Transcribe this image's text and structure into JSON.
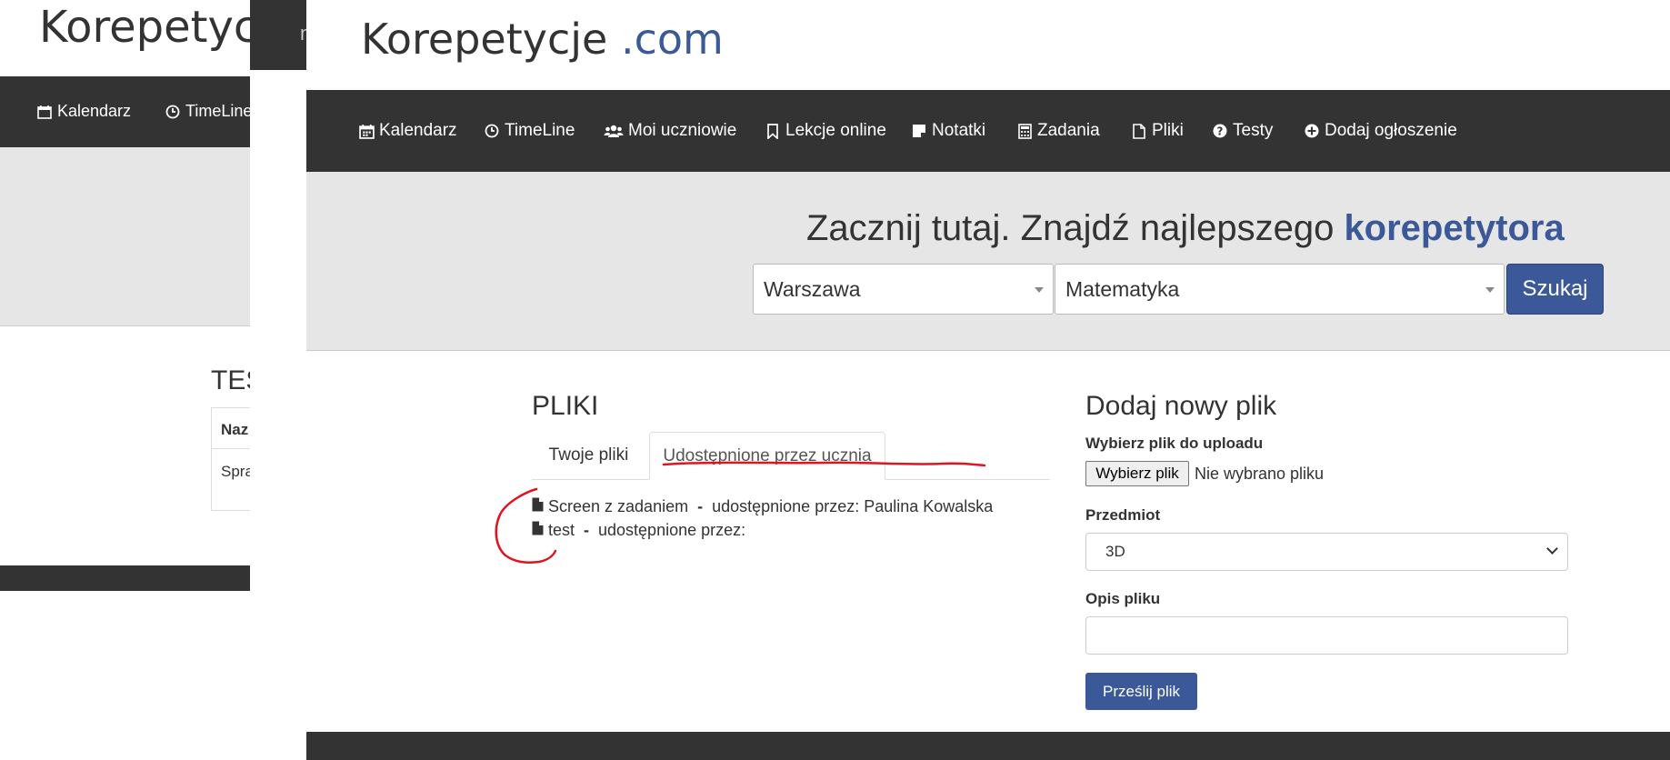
{
  "background_window": {
    "brand_fragment": "Korepetycje",
    "top_bar_glyph": "m",
    "nav": [
      {
        "icon": "calendar-icon",
        "label": "Kalendarz"
      },
      {
        "icon": "clock-icon",
        "label": "TimeLine"
      }
    ],
    "section_title_fragment": "TES",
    "table_header_fragment": "Naz",
    "table_cell_fragment": "Spra"
  },
  "brand": {
    "name": "Korepetycje",
    "tld": ".com"
  },
  "nav": [
    {
      "icon": "calendar-icon",
      "label": "Kalendarz"
    },
    {
      "icon": "clock-icon",
      "label": "TimeLine"
    },
    {
      "icon": "users-icon",
      "label": "Moi uczniowie"
    },
    {
      "icon": "bookmark-icon",
      "label": "Lekcje online"
    },
    {
      "icon": "sticky-note-icon",
      "label": "Notatki"
    },
    {
      "icon": "calculator-icon",
      "label": "Zadania"
    },
    {
      "icon": "file-icon",
      "label": "Pliki"
    },
    {
      "icon": "question-circle-icon",
      "label": "Testy"
    },
    {
      "icon": "plus-circle-icon",
      "label": "Dodaj ogłoszenie"
    }
  ],
  "hero": {
    "title_prefix": "Zacznij tutaj. Znajdź najlepszego",
    "title_highlight": "korepetytora",
    "city_value": "Warszawa",
    "subject_value": "Matematyka",
    "search_label": "Szukaj"
  },
  "files": {
    "title": "PLIKI",
    "tabs": [
      {
        "label": "Twoje pliki",
        "active": false
      },
      {
        "label": "Udostępnione przez ucznia",
        "active": true
      }
    ],
    "items": [
      {
        "name": "Screen z zadaniem",
        "separator": "-",
        "shared_text": "udostępnione przez: Paulina Kowalska"
      },
      {
        "name": "test",
        "separator": "-",
        "shared_text": "udostępnione przez:"
      }
    ]
  },
  "upload": {
    "title": "Dodaj nowy plik",
    "file_label": "Wybierz plik do uploadu",
    "file_button": "Wybierz plik",
    "file_status": "Nie wybrano pliku",
    "subject_label": "Przedmiot",
    "subject_value": "3D",
    "description_label": "Opis pliku",
    "description_value": "",
    "submit_label": "Prześlij plik"
  },
  "colors": {
    "brand_blue": "#3b5998",
    "navbar": "#333333",
    "jumbotron": "#e6e6e6",
    "annotation_red": "#e0141e"
  }
}
